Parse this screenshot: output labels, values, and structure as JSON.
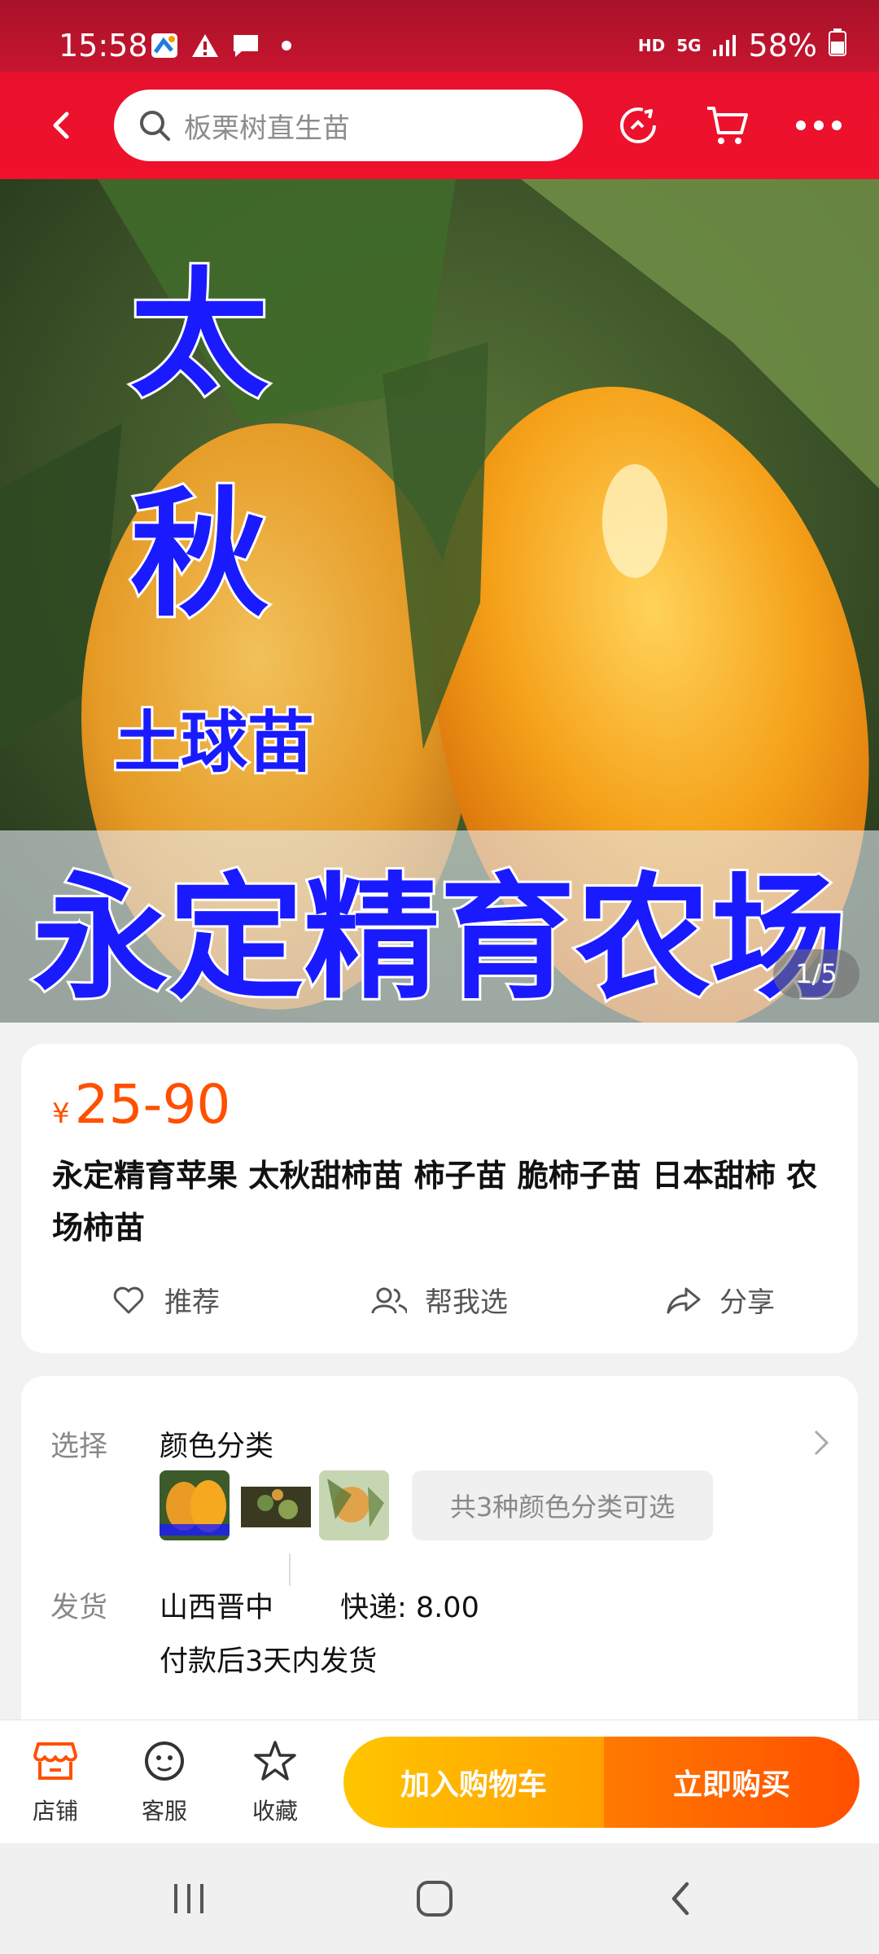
{
  "status_bar": {
    "time": "15:58",
    "network_hd": "HD",
    "network_gen": "5G",
    "battery": "58%"
  },
  "header": {
    "search_placeholder": "板栗树直生苗"
  },
  "gallery": {
    "overlay_text_1": "太",
    "overlay_text_2": "秋",
    "overlay_text_3": "土球苗",
    "overlay_text_4": "永定精育农场",
    "counter": "1/5"
  },
  "product": {
    "currency": "¥",
    "price": "25-90",
    "title": "永定精育苹果 太秋甜柿苗  柿子苗 脆柿子苗  日本甜柿 农场柿苗"
  },
  "actions": {
    "recommend": "推荐",
    "help_choose": "帮我选",
    "share": "分享"
  },
  "options": {
    "select_label": "选择",
    "select_value": "颜色分类",
    "variants_chip": "共3种颜色分类可选",
    "ship_label": "发货",
    "ship_from": "山西晋中",
    "express": "快递: 8.00",
    "ship_time": "付款后3天内发货"
  },
  "bottom_bar": {
    "shop": "店铺",
    "service": "客服",
    "favorite": "收藏",
    "add_to_cart": "加入购物车",
    "buy_now": "立即购买"
  },
  "colors": {
    "brand_red": "#ef112c",
    "price_orange": "#ff5000",
    "cart_yellow": "#ffb300",
    "buy_orange": "#ff6000"
  }
}
